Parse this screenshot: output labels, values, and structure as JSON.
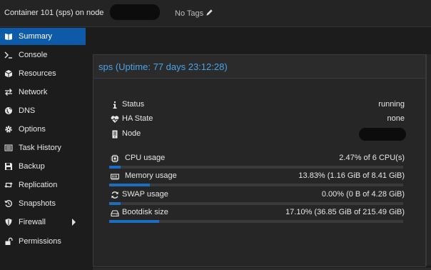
{
  "header": {
    "title": "Container 101 (sps) on node",
    "tags": "No Tags"
  },
  "sidebar": {
    "items": [
      {
        "label": "Summary",
        "icon": "book-icon",
        "active": true
      },
      {
        "label": "Console",
        "icon": "terminal-icon"
      },
      {
        "label": "Resources",
        "icon": "cube-icon"
      },
      {
        "label": "Network",
        "icon": "exchange-icon"
      },
      {
        "label": "DNS",
        "icon": "globe-icon"
      },
      {
        "label": "Options",
        "icon": "gear-icon"
      },
      {
        "label": "Task History",
        "icon": "list-icon"
      },
      {
        "label": "Backup",
        "icon": "floppy-icon"
      },
      {
        "label": "Replication",
        "icon": "retweet-icon"
      },
      {
        "label": "Snapshots",
        "icon": "history-icon"
      },
      {
        "label": "Firewall",
        "icon": "shield-icon",
        "has_submenu": true
      },
      {
        "label": "Permissions",
        "icon": "unlock-icon"
      }
    ]
  },
  "summary": {
    "title": "sps (Uptime: 77 days 23:12:28)",
    "status": {
      "label": "Status",
      "value": "running",
      "icon": "info-icon"
    },
    "ha_state": {
      "label": "HA State",
      "value": "none",
      "icon": "heartbeat-icon"
    },
    "node": {
      "label": "Node",
      "icon": "server-icon"
    },
    "cpu": {
      "label": "CPU usage",
      "value": "2.47% of 6 CPU(s)",
      "percent": 2.47,
      "icon": "cpu-icon"
    },
    "memory": {
      "label": "Memory usage",
      "value": "13.83% (1.16 GiB of 8.41 GiB)",
      "percent": 13.83,
      "icon": "memory-icon"
    },
    "swap": {
      "label": "SWAP usage",
      "value": "0.00% (0 B of 4.28 GiB)",
      "percent": 0.0,
      "icon": "refresh-icon"
    },
    "bootdisk": {
      "label": "Bootdisk size",
      "value": "17.10% (36.85 GiB of 215.49 GiB)",
      "percent": 17.1,
      "icon": "hdd-icon"
    }
  },
  "colors": {
    "accent": "#0c5aa8",
    "title_blue": "#4aa3e8",
    "bar_fill": "#1b6fc0",
    "background": "#1c1c1c"
  }
}
